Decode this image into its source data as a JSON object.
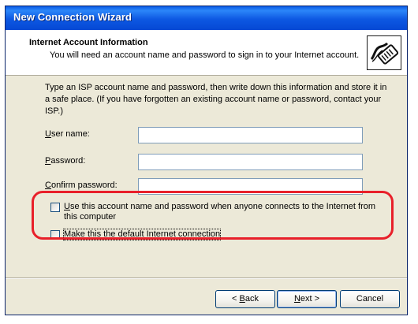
{
  "window": {
    "title": "New Connection Wizard"
  },
  "header": {
    "title": "Internet Account Information",
    "subtitle": "You will need an account name and password to sign in to your Internet account.",
    "icon": "connection-plug-icon"
  },
  "instructions": "Type an ISP account name and password, then write down this information and store it in a safe place. (If you have forgotten an existing account name or password, contact your ISP.)",
  "form": {
    "user_name": {
      "label_acc": "U",
      "label_rest": "ser name:",
      "value": ""
    },
    "password": {
      "label_acc": "P",
      "label_rest": "assword:",
      "value": ""
    },
    "confirm_password": {
      "label_acc": "C",
      "label_rest": "onfirm password:",
      "value": ""
    }
  },
  "options": {
    "use_for_all": {
      "label_acc": "U",
      "label_rest": "se this account  name and password when anyone connects to the Internet from this computer",
      "checked": false
    },
    "default_connection": {
      "label_acc": "M",
      "label_rest": "ake this the default Internet connection",
      "checked": false
    }
  },
  "buttons": {
    "back": {
      "prefix": "< ",
      "acc": "B",
      "rest": "ack"
    },
    "next": {
      "acc": "N",
      "rest": "ext >"
    },
    "cancel": {
      "label": "Cancel"
    }
  },
  "colors": {
    "titlebar": "#0a5be6",
    "dialog_bg": "#ece9d8",
    "highlight": "#e8202a"
  }
}
